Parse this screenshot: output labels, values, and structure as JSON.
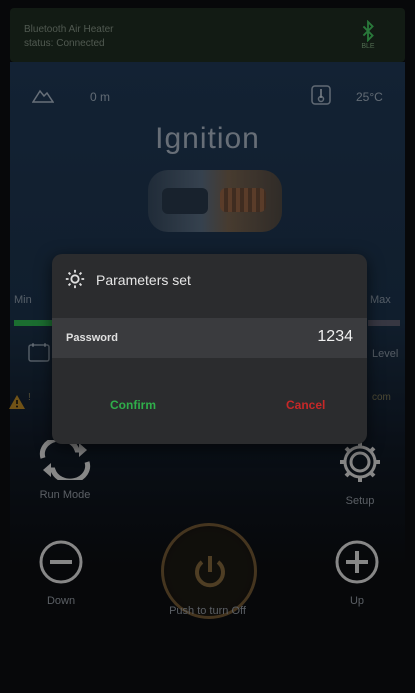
{
  "top_bar": {
    "line1": "Bluetooth Air Heater",
    "line2": "status: Connected",
    "bluetooth_label": "BLE"
  },
  "status": {
    "altitude": "0 m",
    "temperature": "25°C"
  },
  "main": {
    "title": "Ignition",
    "min_label": "Min",
    "max_label": "Max",
    "level_label": "Level",
    "warning_left_1": "!",
    "warning_left_2": "",
    "warning_right_1": "com"
  },
  "controls": {
    "run_mode": "Run Mode",
    "setup": "Setup",
    "down": "Down",
    "up": "Up",
    "power": "Push to turn Off"
  },
  "dialog": {
    "title": "Parameters set",
    "password_label": "Password",
    "password_value": "1234",
    "confirm": "Confirm",
    "cancel": "Cancel"
  },
  "colors": {
    "confirm": "#2fae4a",
    "cancel": "#c62828",
    "level_bar": "#2aa84a"
  }
}
